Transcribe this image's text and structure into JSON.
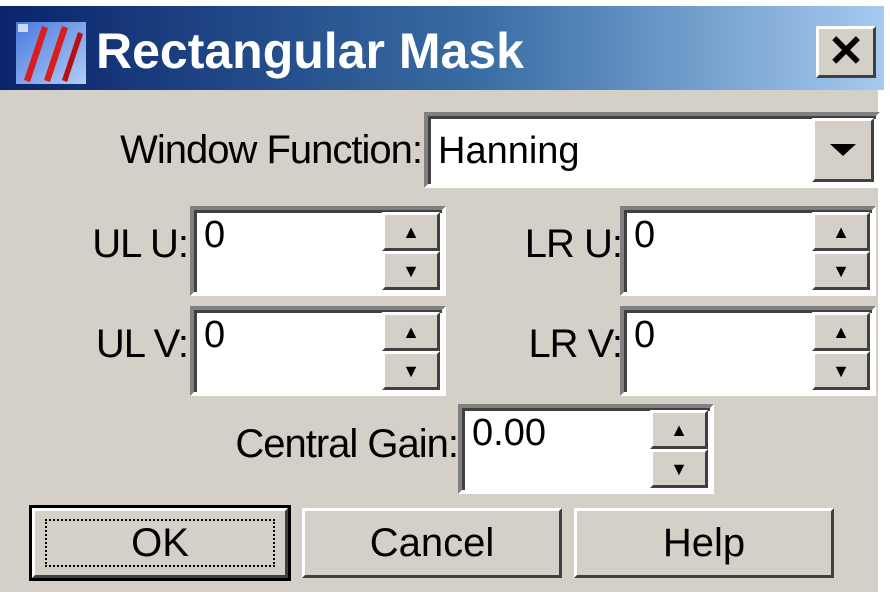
{
  "window": {
    "title": "Rectangular Mask",
    "close_label": "✕"
  },
  "form": {
    "window_function": {
      "label": "Window Function:",
      "value": "Hanning"
    },
    "ul_u": {
      "label": "UL U:",
      "value": "0"
    },
    "lr_u": {
      "label": "LR U:",
      "value": "0"
    },
    "ul_v": {
      "label": "UL V:",
      "value": "0"
    },
    "lr_v": {
      "label": "LR V:",
      "value": "0"
    },
    "central_gain": {
      "label": "Central Gain:",
      "value": "0.00"
    }
  },
  "buttons": {
    "ok": "OK",
    "cancel": "Cancel",
    "help": "Help"
  },
  "icons": {
    "app": "app-icon",
    "close": "close-icon",
    "dropdown": "chevron-down-icon",
    "spin_up": "spin-up-icon",
    "spin_down": "spin-down-icon"
  },
  "colors": {
    "title_gradient_start": "#0a246a",
    "title_gradient_end": "#a6caf0",
    "dialog_face": "#d4d0c8"
  }
}
